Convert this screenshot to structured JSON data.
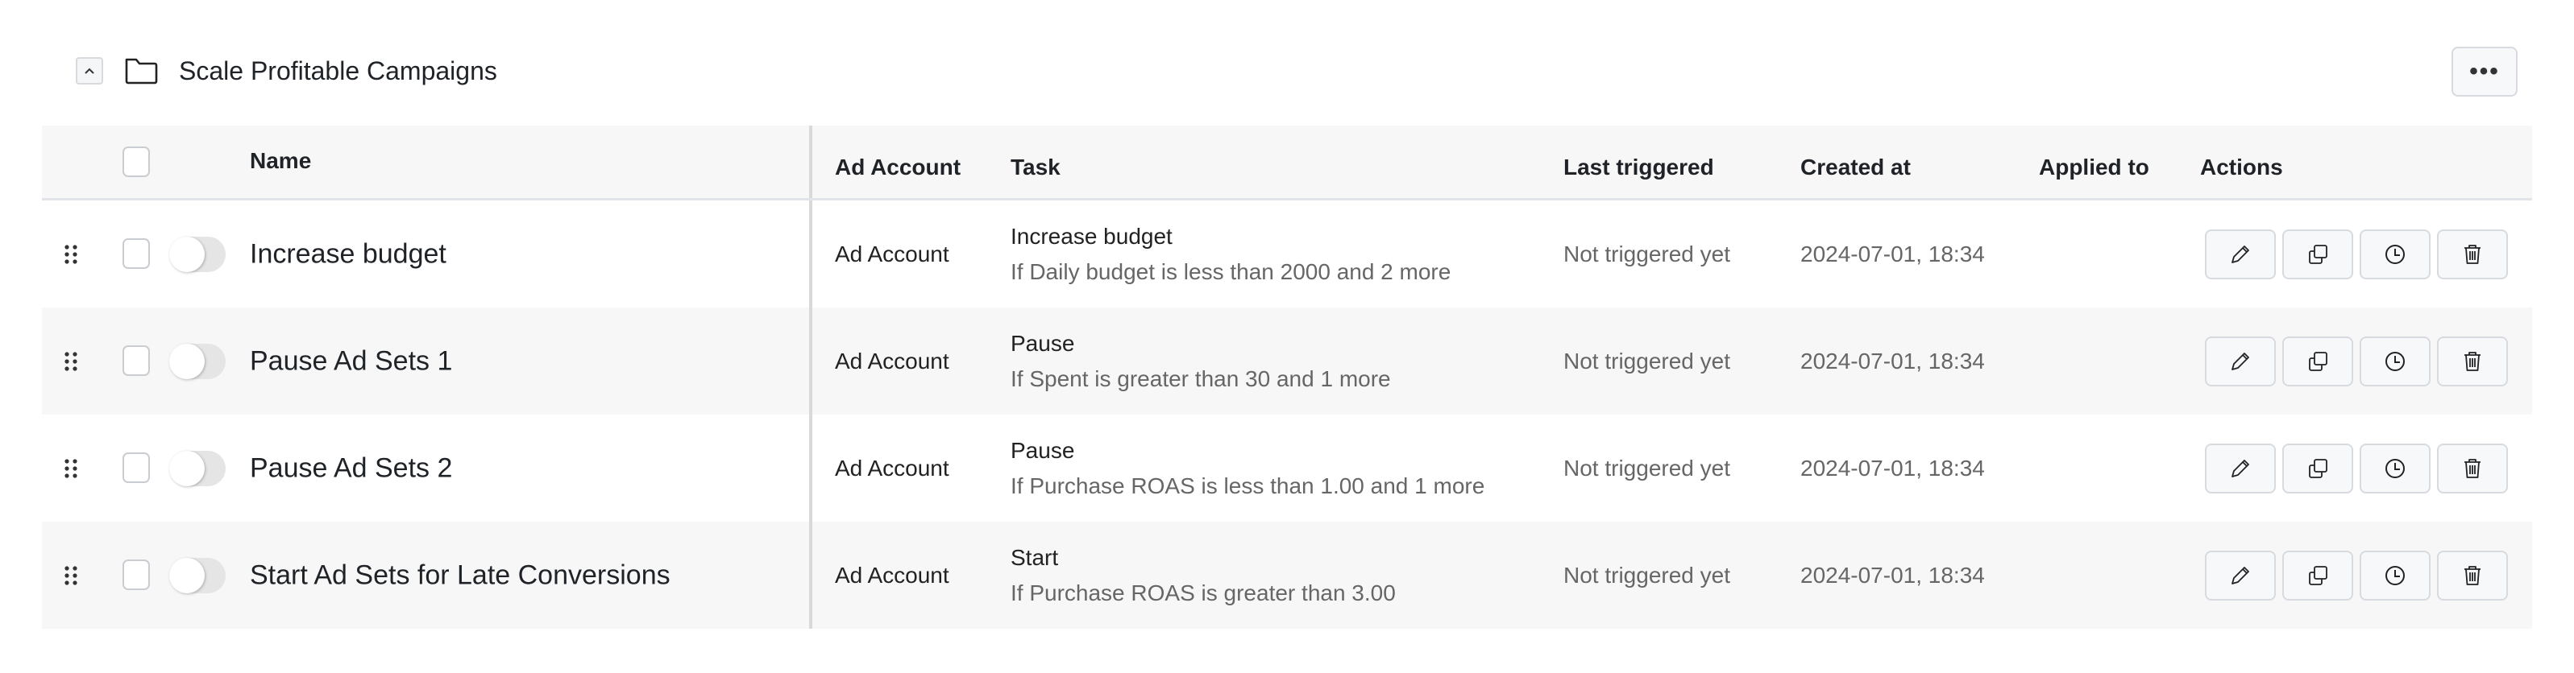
{
  "group": {
    "title": "Scale Profitable Campaigns",
    "collapse_icon": "chevron-up-icon",
    "folder_icon": "folder-icon",
    "more_label": "•••"
  },
  "table": {
    "headers": {
      "name": "Name",
      "ad_account": "Ad Account",
      "task": "Task",
      "last_triggered": "Last triggered",
      "created_at": "Created at",
      "applied_to": "Applied to",
      "actions": "Actions"
    },
    "rows": [
      {
        "name": "Increase budget",
        "enabled": false,
        "ad_account": "Ad Account",
        "task_title": "Increase budget",
        "task_condition": "If Daily budget is less than 2000 and 2 more",
        "last_triggered": "Not triggered yet",
        "created_at": "2024-07-01, 18:34",
        "applied_to": ""
      },
      {
        "name": "Pause Ad Sets 1",
        "enabled": false,
        "ad_account": "Ad Account",
        "task_title": "Pause",
        "task_condition": "If Spent is greater than 30 and 1 more",
        "last_triggered": "Not triggered yet",
        "created_at": "2024-07-01, 18:34",
        "applied_to": ""
      },
      {
        "name": "Pause Ad Sets 2",
        "enabled": false,
        "ad_account": "Ad Account",
        "task_title": "Pause",
        "task_condition": "If Purchase ROAS is less than 1.00 and 1 more",
        "last_triggered": "Not triggered yet",
        "created_at": "2024-07-01, 18:34",
        "applied_to": ""
      },
      {
        "name": "Start Ad Sets for Late Conversions",
        "enabled": false,
        "ad_account": "Ad Account",
        "task_title": "Start",
        "task_condition": "If Purchase ROAS is greater than 3.00",
        "last_triggered": "Not triggered yet",
        "created_at": "2024-07-01, 18:34",
        "applied_to": ""
      }
    ],
    "action_icons": [
      "pencil-icon",
      "copy-icon",
      "clock-icon",
      "trash-icon"
    ]
  }
}
